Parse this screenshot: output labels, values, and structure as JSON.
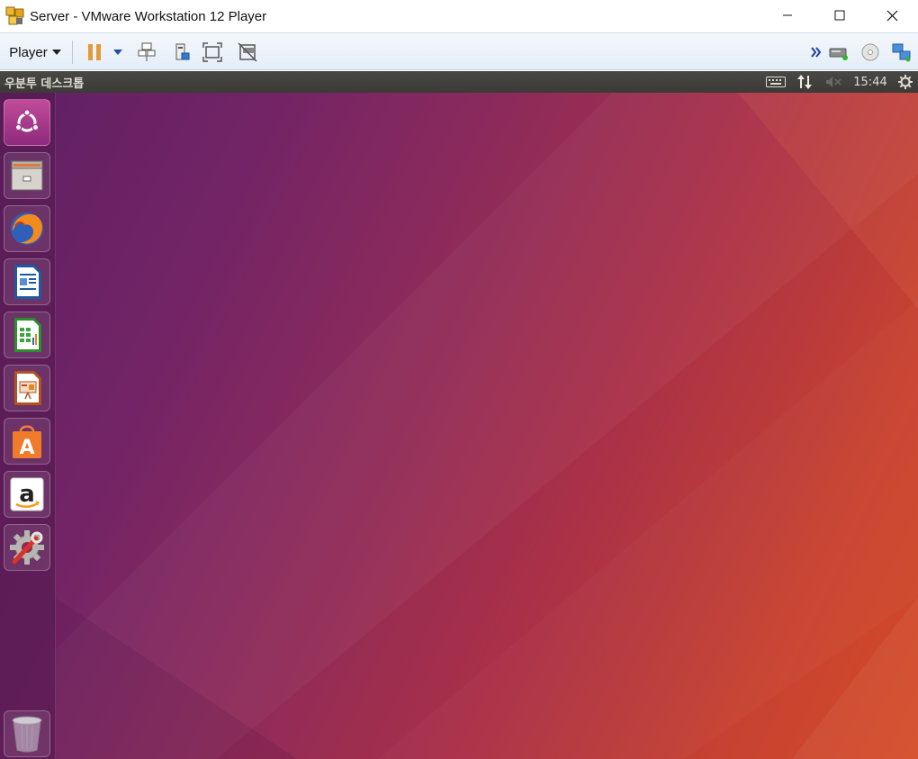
{
  "window": {
    "title": "Server - VMware Workstation 12 Player",
    "controls": [
      "minimize",
      "maximize",
      "close"
    ]
  },
  "toolbar": {
    "player_menu": "Player",
    "left_icons": [
      "pause-icon",
      "dropdown-arrow-icon",
      "send-ctrl-alt-del-icon",
      "removable-devices-icon",
      "full-screen-icon",
      "unity-icon"
    ],
    "right_icons": [
      "more-chevrons-icon",
      "hard-disk-icon",
      "cd-dvd-icon",
      "network-icon"
    ]
  },
  "panel": {
    "title": "우분투 데스크톱",
    "clock": "15:44",
    "indicators": [
      "keyboard-icon",
      "network-updown-icon",
      "volume-muted-icon",
      "system-gear-icon"
    ]
  },
  "launcher": {
    "items": [
      {
        "name": "dash-home",
        "icon": "ubuntu-logo-icon"
      },
      {
        "name": "files",
        "icon": "file-cabinet-icon"
      },
      {
        "name": "firefox",
        "icon": "firefox-icon"
      },
      {
        "name": "libreoffice-writer",
        "icon": "writer-document-icon"
      },
      {
        "name": "libreoffice-calc",
        "icon": "calc-spreadsheet-icon"
      },
      {
        "name": "libreoffice-impress",
        "icon": "impress-presentation-icon"
      },
      {
        "name": "ubuntu-software",
        "icon": "software-bag-icon"
      },
      {
        "name": "amazon",
        "icon": "amazon-logo-icon"
      },
      {
        "name": "system-settings",
        "icon": "settings-wrench-icon"
      }
    ],
    "trash": {
      "name": "trash",
      "icon": "trash-icon"
    }
  },
  "colors": {
    "panel_bg": "#3c3b37",
    "desktop_start": "#5e2063",
    "desktop_end": "#d44b28",
    "toolbar_bg": "#e8eff7"
  }
}
